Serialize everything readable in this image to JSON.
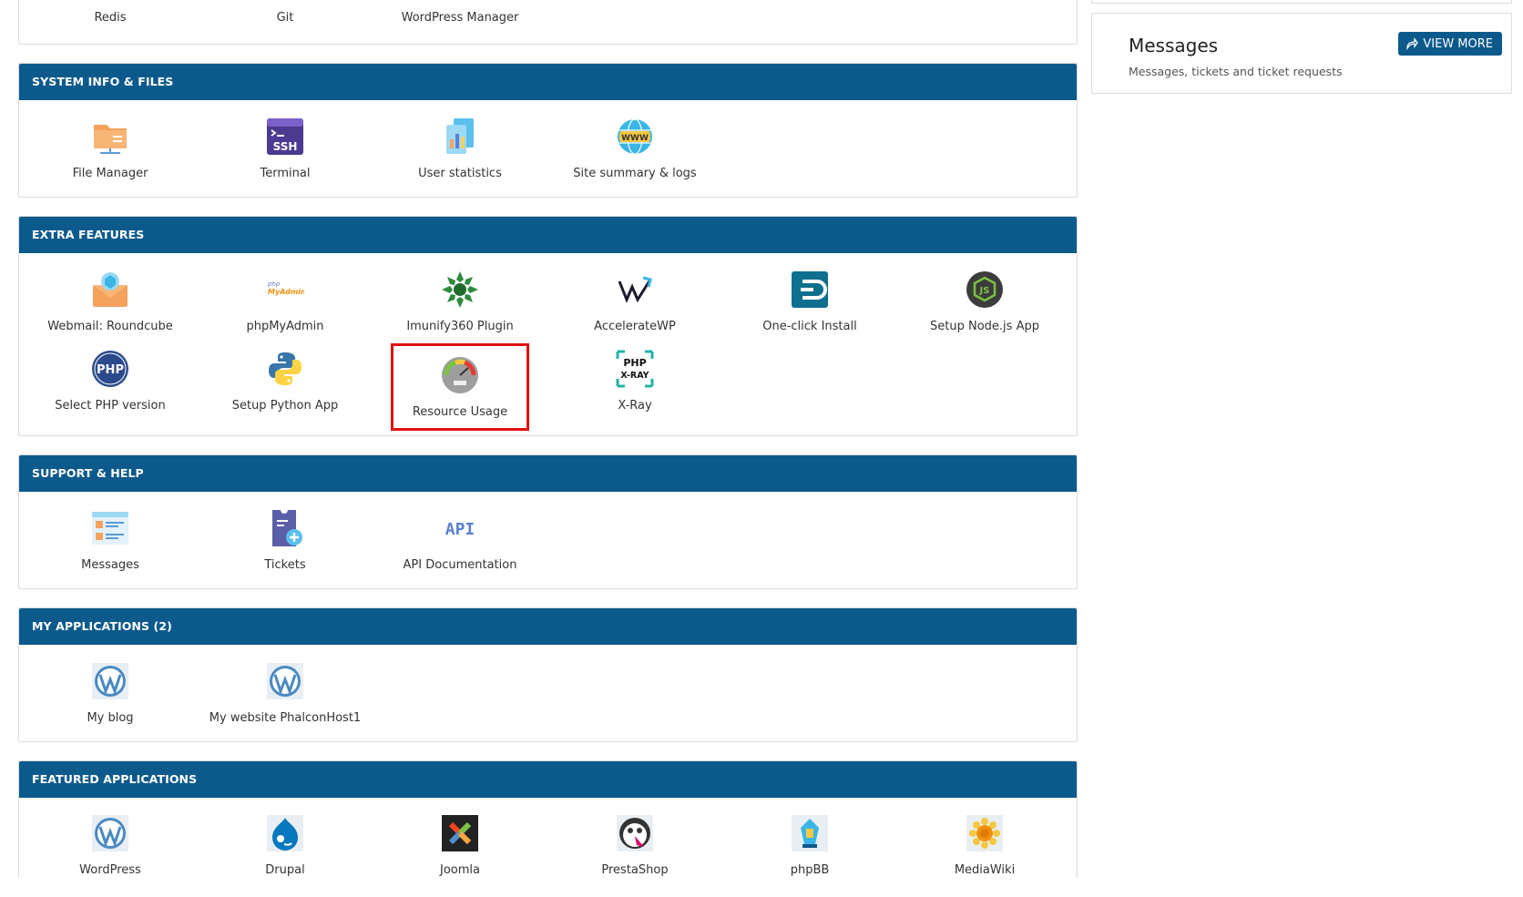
{
  "top_row": {
    "items": [
      "Redis",
      "Git",
      "WordPress Manager"
    ]
  },
  "system_info": {
    "title": "SYSTEM INFO & FILES",
    "items": [
      "File Manager",
      "Terminal",
      "User statistics",
      "Site summary & logs"
    ]
  },
  "extra_features": {
    "title": "EXTRA FEATURES",
    "items": [
      "Webmail: Roundcube",
      "phpMyAdmin",
      "Imunify360 Plugin",
      "AccelerateWP",
      "One-click Install",
      "Setup Node.js App",
      "Select PHP version",
      "Setup Python App",
      "Resource Usage",
      "X-Ray"
    ]
  },
  "support": {
    "title": "SUPPORT & HELP",
    "items": [
      "Messages",
      "Tickets",
      "API Documentation"
    ]
  },
  "my_apps": {
    "title": "MY APPLICATIONS (2)",
    "items": [
      "My blog",
      "My website PhalconHost1"
    ]
  },
  "featured": {
    "title": "FEATURED APPLICATIONS",
    "items": [
      "WordPress",
      "Drupal",
      "Joomla",
      "PrestaShop",
      "phpBB",
      "MediaWiki"
    ]
  },
  "messages_card": {
    "title": "Messages",
    "subtitle": "Messages, tickets and ticket requests",
    "button": "VIEW MORE"
  },
  "icons": {
    "php_text": "PHP",
    "ssh_text": "SSH",
    "www_text": "WWW",
    "api_text": "API",
    "xray_php": "PHP",
    "xray_text": "X-RAY",
    "pma_text": "phpMyAdmin",
    "node_text": "JS"
  },
  "colors": {
    "header": "#0c5a8c",
    "highlight": "#e01010"
  }
}
